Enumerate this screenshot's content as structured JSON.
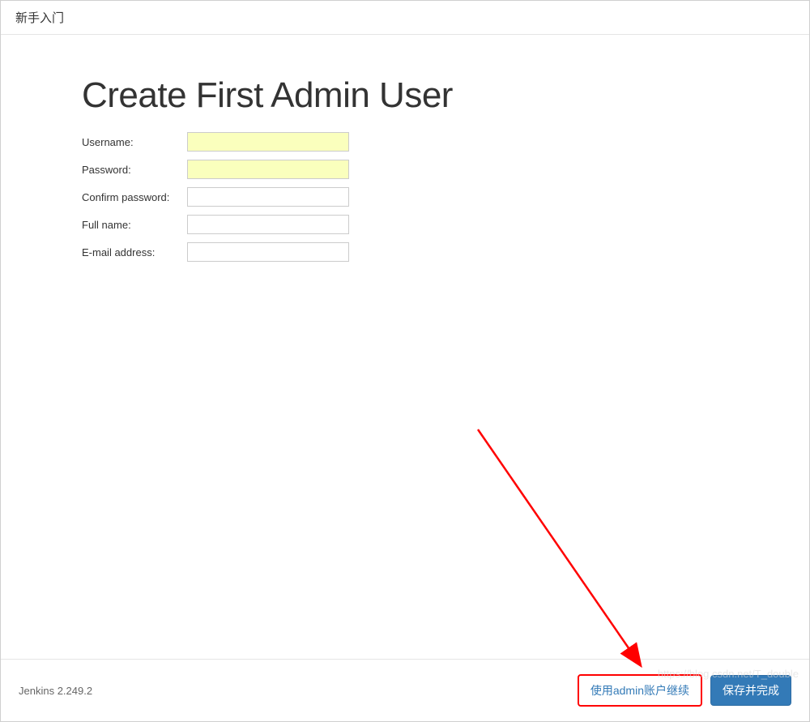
{
  "header": {
    "title": "新手入门"
  },
  "main": {
    "heading": "Create First Admin User",
    "fields": {
      "username": {
        "label": "Username:",
        "value": ""
      },
      "password": {
        "label": "Password:",
        "value": ""
      },
      "confirm_password": {
        "label": "Confirm password:",
        "value": ""
      },
      "full_name": {
        "label": "Full name:",
        "value": ""
      },
      "email": {
        "label": "E-mail address:",
        "value": ""
      }
    }
  },
  "footer": {
    "version": "Jenkins 2.249.2",
    "continue_as_admin": "使用admin账户继续",
    "save_and_finish": "保存并完成"
  },
  "watermark": "https://blog.csdn.net/T_double"
}
